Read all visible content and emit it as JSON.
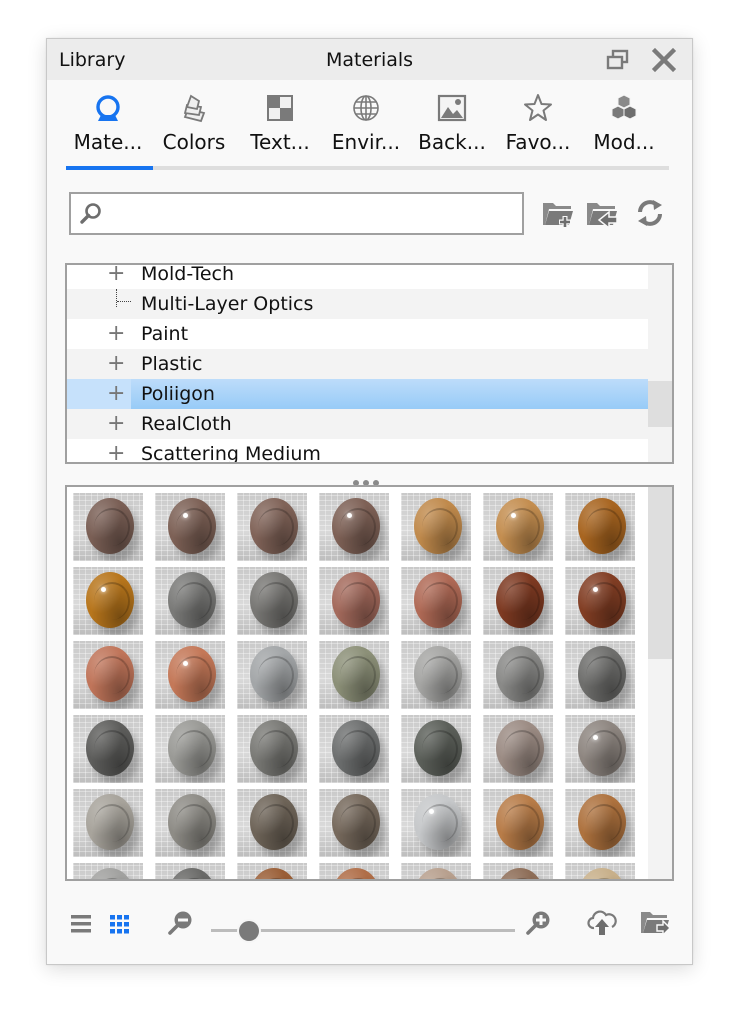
{
  "window": {
    "panel_label": "Library",
    "title": "Materials",
    "controls": {
      "restore": "restore-window",
      "close": "close-window"
    }
  },
  "tabs": [
    {
      "label": "Mate...",
      "full": "Materials",
      "icon": "materials-icon",
      "active": true
    },
    {
      "label": "Colors",
      "full": "Colors",
      "icon": "color-swatches-icon",
      "active": false
    },
    {
      "label": "Text...",
      "full": "Textures",
      "icon": "texture-icon",
      "active": false
    },
    {
      "label": "Envir...",
      "full": "Environments",
      "icon": "globe-icon",
      "active": false
    },
    {
      "label": "Back...",
      "full": "Backplates",
      "icon": "image-icon",
      "active": false
    },
    {
      "label": "Favo...",
      "full": "Favorites",
      "icon": "star-icon",
      "active": false
    },
    {
      "label": "Mod...",
      "full": "Models",
      "icon": "cubes-icon",
      "active": false
    }
  ],
  "accent_color": "#1774f0",
  "search": {
    "value": "",
    "placeholder": ""
  },
  "actions": [
    {
      "name": "add-folder-button",
      "icon": "folder-add-icon"
    },
    {
      "name": "import-folder-button",
      "icon": "folder-import-icon"
    },
    {
      "name": "refresh-button",
      "icon": "refresh-icon"
    }
  ],
  "tree": {
    "items": [
      {
        "label": "Mold-Tech",
        "expandable": true,
        "selected": false
      },
      {
        "label": "Multi-Layer Optics",
        "expandable": false,
        "selected": false
      },
      {
        "label": "Paint",
        "expandable": true,
        "selected": false
      },
      {
        "label": "Plastic",
        "expandable": true,
        "selected": false
      },
      {
        "label": "Poliigon",
        "expandable": true,
        "selected": true
      },
      {
        "label": "RealCloth",
        "expandable": true,
        "selected": false
      },
      {
        "label": "Scattering Medium",
        "expandable": true,
        "selected": false
      }
    ]
  },
  "thumbnails": [
    [
      "#7a5f55",
      "#7d6156",
      "#806358",
      "#7e6156",
      "#c08a4c",
      "#c48e50",
      "#a86520"
    ],
    [
      "#b8761c",
      "#7a7a78",
      "#787774",
      "#a46a5c",
      "#b06a56",
      "#7e3a22",
      "#823e24"
    ],
    [
      "#c0755a",
      "#c47858",
      "#a3a6a8",
      "#8c9078",
      "#a6a6a4",
      "#8a8a88",
      "#6e6e6c"
    ],
    [
      "#5e5e5c",
      "#9a9a96",
      "#7a7a76",
      "#6e7070",
      "#5c605a",
      "#9c8c84",
      "#8e8680"
    ],
    [
      "#a8a49c",
      "#8e8c86",
      "#6e6458",
      "#76695c",
      "#c6c8ca",
      "#b87c48",
      "#ae723e"
    ],
    [
      "#a2a2a0",
      "#6a6a68",
      "#9a5e36",
      "#b06e48",
      "#b8a08e",
      "#8e6e58",
      "#c8b08a"
    ]
  ],
  "thumbnail_specular": [
    [
      false,
      true,
      false,
      true,
      false,
      true,
      false
    ],
    [
      true,
      false,
      false,
      false,
      false,
      false,
      true
    ],
    [
      false,
      true,
      false,
      false,
      false,
      false,
      false
    ],
    [
      false,
      false,
      false,
      false,
      false,
      false,
      true
    ],
    [
      false,
      false,
      false,
      false,
      true,
      false,
      false
    ],
    [
      false,
      false,
      false,
      false,
      false,
      false,
      false
    ]
  ],
  "bottom": {
    "view_modes": [
      {
        "name": "list-view-button",
        "icon": "list-icon",
        "active": false
      },
      {
        "name": "grid-view-button",
        "icon": "grid-icon",
        "active": true
      }
    ],
    "zoom_slider_value": 0.06,
    "buttons": [
      {
        "name": "upload-cloud-button",
        "icon": "cloud-upload-icon"
      },
      {
        "name": "export-folder-button",
        "icon": "folder-export-icon"
      }
    ]
  }
}
